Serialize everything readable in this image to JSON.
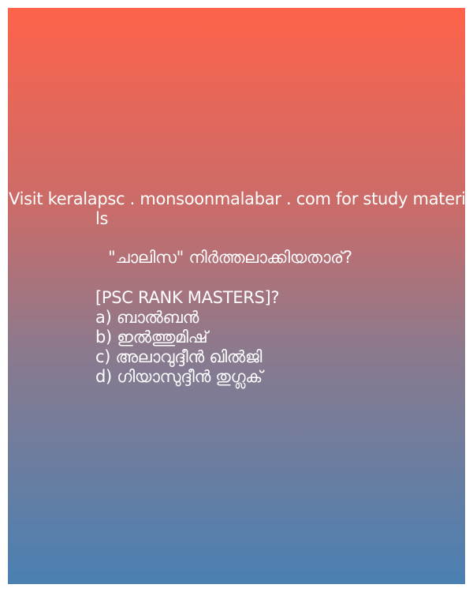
{
  "post": {
    "visit_line1": "Visit keralapsc . monsoonmalabar . com for study materia",
    "visit_line2": "ls",
    "question": "\"ചാലിസ\" നിർത്തലാക്കിയതാര്?",
    "source": "[PSC RANK MASTERS]?",
    "options": [
      "a) ബാൽബൻ",
      "b) ഇൽത്തുമിഷ്",
      "c) അലാവുദ്ദീൻ ഖിൽജി",
      "d) ഗിയാസുദ്ദീൻ തുഗ്ലക്"
    ],
    "colors": {
      "gradient_top": "#fe634a",
      "gradient_bottom": "#4a80b2",
      "text": "#ffffff"
    }
  }
}
